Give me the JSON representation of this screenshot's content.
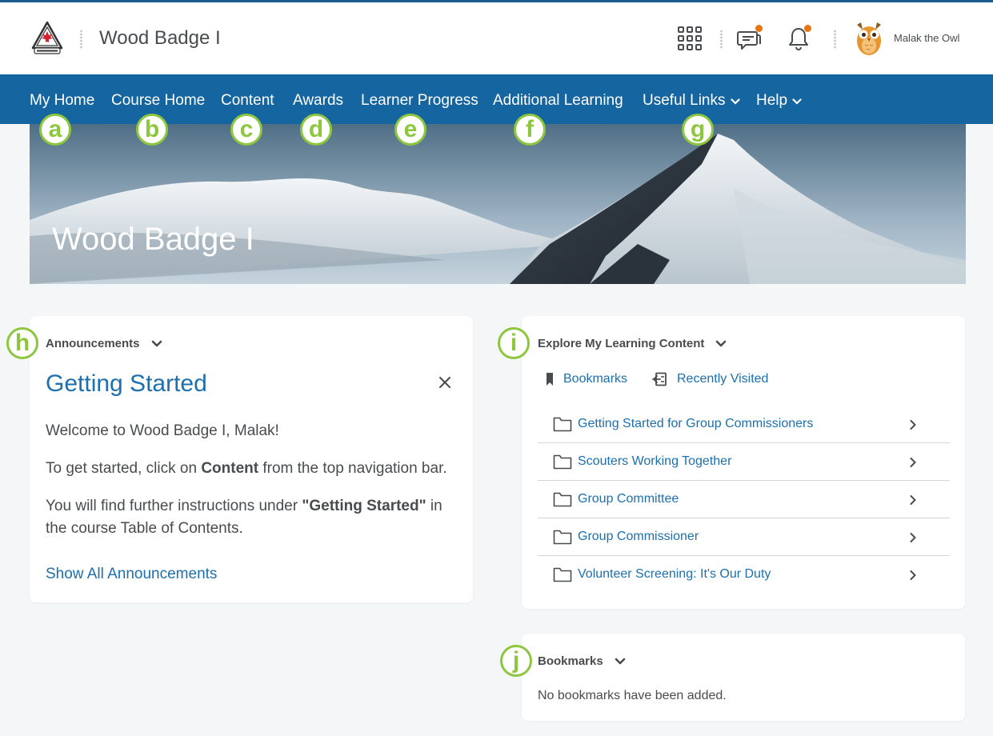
{
  "header": {
    "site_title": "Wood Badge I",
    "logo_name": "scouts-canada-logo",
    "icons": [
      "apps-grid-icon",
      "message-alerts-icon",
      "notifications-bell-icon"
    ],
    "user_name": "Malak the Owl",
    "accent_dot_color": "#e87511"
  },
  "nav": {
    "items": [
      {
        "label": "My Home",
        "marker": "a"
      },
      {
        "label": "Course Home",
        "marker": "b"
      },
      {
        "label": "Content",
        "marker": "c"
      },
      {
        "label": "Awards",
        "marker": "d"
      },
      {
        "label": "Learner Progress",
        "marker": "e"
      },
      {
        "label": "Additional Learning",
        "marker": "f"
      },
      {
        "label": "Useful Links",
        "marker": "g"
      },
      {
        "label": "Help"
      }
    ],
    "bar_color": "#1565a0"
  },
  "banner": {
    "title": "Wood Badge I"
  },
  "announcements": {
    "marker": "h",
    "title": "Announcements",
    "heading": "Getting Started",
    "line1": "Welcome to Wood Badge I, Malak!",
    "line2_before": "To get started, click on ",
    "line2_bold": "Content",
    "line2_after": " from the top navigation bar.",
    "line3_before": "You will find further instructions under ",
    "line3_bold": "\"Getting Started\"",
    "line3_after_1": " in",
    "line3_after_2": "the course Table of Contents.",
    "show_all": "Show All Announcements"
  },
  "explore": {
    "marker": "i",
    "title": "Explore My Learning Content",
    "bookmarks_link": "Bookmarks",
    "recent_link": "Recently Visited",
    "modules": [
      "Getting Started for Group Commissioners",
      "Scouters Working Together",
      "Group Committee",
      "Group Commissioner",
      "Volunteer Screening: It's Our Duty"
    ]
  },
  "bookmarks": {
    "marker": "j",
    "title": "Bookmarks",
    "empty_text": "No bookmarks have been added."
  },
  "colors": {
    "link": "#1d6fad",
    "marker_green": "#8dc63f"
  }
}
